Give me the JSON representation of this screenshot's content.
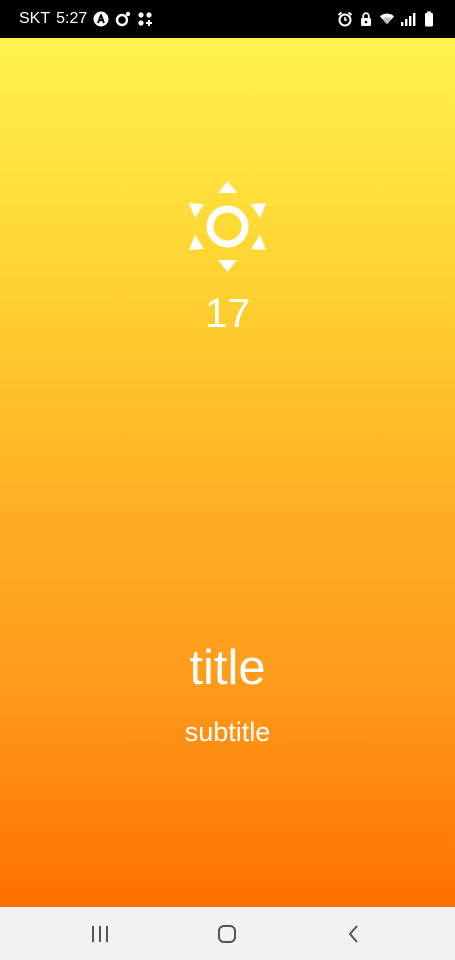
{
  "status_bar": {
    "carrier": "SKT",
    "time": "5:27",
    "left_icons": [
      "app-a-icon",
      "ring-notification-icon",
      "app-grid-icon"
    ],
    "right_icons": [
      "alarm-icon",
      "lock-icon",
      "wifi-icon",
      "signal-icon",
      "battery-icon"
    ]
  },
  "weather": {
    "icon": "sun-icon",
    "temperature": "17",
    "title": "title",
    "subtitle": "subtitle"
  },
  "nav_bar": {
    "buttons": [
      "recent-apps-button",
      "home-button",
      "back-button"
    ]
  },
  "colors": {
    "gradient_top": "#FFF350",
    "gradient_bottom": "#FF7000",
    "text": "#FFFFFF",
    "status_bar": "#000000",
    "nav_bar": "#F2F2F2"
  }
}
